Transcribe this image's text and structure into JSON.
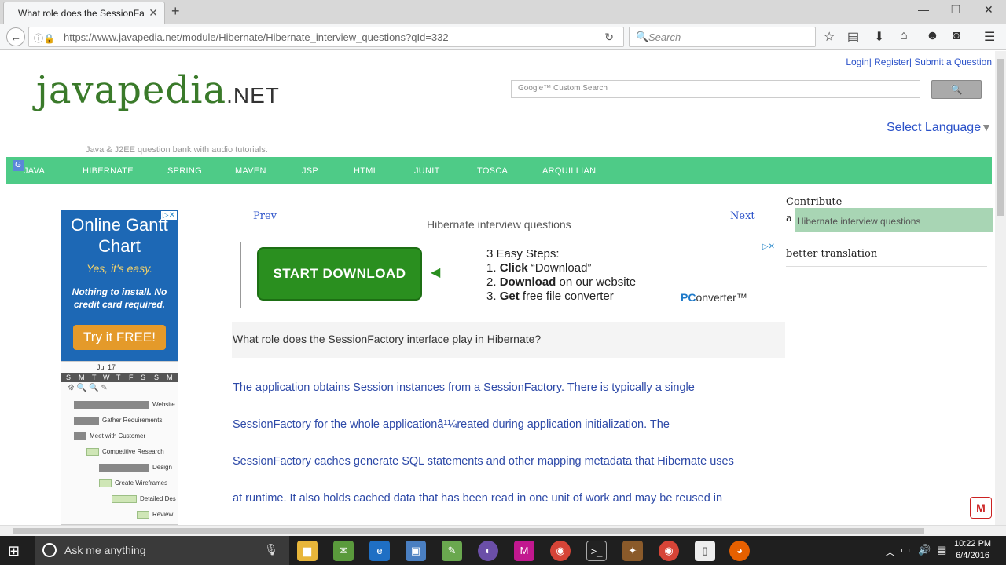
{
  "browser": {
    "tab_title": "What role does the SessionFac…",
    "url": "https://www.javapedia.net/module/Hibernate/Hibernate_interview_questions?qId=332",
    "search_placeholder": "Search",
    "new_tab": "+",
    "tab_close": "✕"
  },
  "header": {
    "top_links": "Login| Register| Submit a Question",
    "logo_main": "javapedia",
    "logo_suffix": ".NET",
    "tagline": "Java & J2EE question bank with audio tutorials.",
    "gsearch_placeholder": "Google™ Custom Search",
    "gsearch_button": "🔍",
    "select_language": "Select Language",
    "select_arrow": "▼"
  },
  "menu": {
    "items": [
      "JAVA",
      "HIBERNATE",
      "SPRING",
      "MAVEN",
      "JSP",
      "HTML",
      "JUNIT",
      "TOSCA",
      "ARQUILLIAN"
    ]
  },
  "left_ad": {
    "heading": "Online Gantt Chart",
    "easy": "Yes, it's easy.",
    "note": "Nothing to install. No credit card required.",
    "cta": "Try it FREE!",
    "month": "Jul 17",
    "days": [
      "S",
      "M",
      "T",
      "W",
      "T",
      "F",
      "S",
      "S",
      "M"
    ],
    "tasks": [
      "Website",
      "Gather Requirements",
      "Meet with Customer",
      "Competitive Research",
      "Design",
      "Create Wireframes",
      "Detailed Des",
      "Review"
    ]
  },
  "content": {
    "prev": "Prev",
    "next": "Next",
    "title": "Hibernate interview questions",
    "question": "What role does the SessionFactory interface play in Hibernate?",
    "answer_lines": [
      "The application obtains Session instances from a SessionFactory. There is typically a single",
      "SessionFactory for the whole applicationâ¹¼reated during application initialization. The",
      "SessionFactory caches generate SQL statements and other mapping metadata that Hibernate uses",
      "at runtime. It also holds cached data that has been read in one unit of work and may be reused in"
    ]
  },
  "banner_ad": {
    "button": "START DOWNLOAD",
    "steps_title": "3 Easy Steps:",
    "step1_num": "1. ",
    "step1_bold": "Click",
    "step1_rest": " “Download”",
    "step2_num": "2. ",
    "step2_bold": "Download",
    "step2_rest": " on our website",
    "step3_num": "3. ",
    "step3_bold": "Get",
    "step3_rest": " free file converter",
    "brand_pc": "PC",
    "brand_rest": "onverter™"
  },
  "sidebar": {
    "contribute": "Contribute",
    "a": "a",
    "selected": "Hibernate interview questions",
    "better": "better translation"
  },
  "taskbar": {
    "search_placeholder": "Ask me anything",
    "time": "10:22 PM",
    "date": "6/4/2016"
  },
  "colors": {
    "menu_bg": "#4ecb87",
    "link": "#2b52c9",
    "answer_text": "#2e4aa8",
    "ad_blue": "#1d68b5",
    "download_green": "#2a8f1f"
  }
}
